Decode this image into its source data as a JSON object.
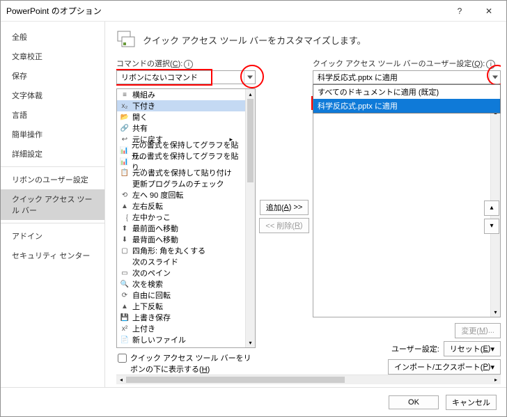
{
  "title": "PowerPoint のオプション",
  "heading": "クイック アクセス ツール バーをカスタマイズします。",
  "sidebar": {
    "items": [
      {
        "label": "全般"
      },
      {
        "label": "文章校正"
      },
      {
        "label": "保存"
      },
      {
        "label": "文字体裁"
      },
      {
        "label": "言語"
      },
      {
        "label": "簡単操作"
      },
      {
        "label": "詳細設定"
      }
    ],
    "items2": [
      {
        "label": "リボンのユーザー設定"
      },
      {
        "label": "クイック アクセス ツール バー",
        "selected": true
      }
    ],
    "items3": [
      {
        "label": "アドイン"
      },
      {
        "label": "セキュリティ センター"
      }
    ]
  },
  "left": {
    "label_prefix": "コマンドの選択(",
    "label_key": "C",
    "label_suffix": "):",
    "dropdown_value": "リボンにないコマンド",
    "commands": [
      {
        "icon": "≡",
        "label": "横組み"
      },
      {
        "icon": "x₂",
        "label": "下付き",
        "selected": true
      },
      {
        "icon": "📂",
        "label": "開く"
      },
      {
        "icon": "🔗",
        "label": "共有"
      },
      {
        "icon": "↩",
        "label": "元に戻す",
        "sub": "▸"
      },
      {
        "icon": "📊",
        "label": "元の書式を保持してグラフを貼り..."
      },
      {
        "icon": "📊",
        "label": "元の書式を保持してグラフを貼り..."
      },
      {
        "icon": "📋",
        "label": "元の書式を保持して貼り付け"
      },
      {
        "icon": "",
        "label": "更新プログラムのチェック"
      },
      {
        "icon": "⟲",
        "label": "左へ 90 度回転"
      },
      {
        "icon": "▲",
        "label": "左右反転"
      },
      {
        "icon": "｛",
        "label": "左中かっこ"
      },
      {
        "icon": "⬆",
        "label": "最前面へ移動"
      },
      {
        "icon": "⬇",
        "label": "最背面へ移動"
      },
      {
        "icon": "▢",
        "label": "四角形: 角を丸くする"
      },
      {
        "icon": "",
        "label": "次のスライド"
      },
      {
        "icon": "▭",
        "label": "次のペイン"
      },
      {
        "icon": "🔍",
        "label": "次を検索"
      },
      {
        "icon": "⟳",
        "label": "自由に回転"
      },
      {
        "icon": "▲",
        "label": "上下反転"
      },
      {
        "icon": "💾",
        "label": "上書き保存"
      },
      {
        "icon": "x²",
        "label": "上付き"
      },
      {
        "icon": "📄",
        "label": "新しいファイル"
      }
    ],
    "checkbox_label": "クイック アクセス ツール バーをリボンの下に表示する(",
    "checkbox_key": "H",
    "checkbox_suffix": ")"
  },
  "mid": {
    "add_prefix": "追加(",
    "add_key": "A",
    "add_suffix": ") >>",
    "remove_prefix": "<< 削除(",
    "remove_key": "R",
    "remove_suffix": ")"
  },
  "right": {
    "label_prefix": "クイック アクセス ツール バーのユーザー設定(",
    "label_key": "Q",
    "label_suffix": "):",
    "dropdown_value": "科学反応式.pptx に適用",
    "menu": [
      {
        "label": "すべてのドキュメントに適用 (既定)"
      },
      {
        "label": "科学反応式.pptx に適用",
        "selected": true
      }
    ],
    "change_prefix": "変更(",
    "change_key": "M",
    "change_suffix": ")...",
    "user_label": "ユーザー設定:",
    "reset_prefix": "リセット(",
    "reset_key": "E",
    "reset_arrow": " ▾",
    "import_prefix": "インポート/エクスポート(",
    "import_key": "P",
    "import_arrow": " ▾"
  },
  "footer": {
    "ok": "OK",
    "cancel": "キャンセル"
  }
}
